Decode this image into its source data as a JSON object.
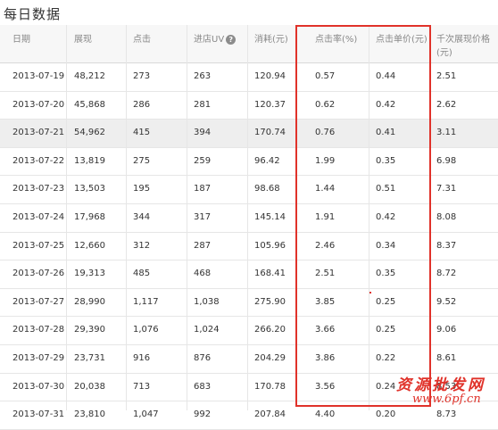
{
  "page": {
    "title": "每日数据"
  },
  "table": {
    "columns": [
      {
        "label": "日期"
      },
      {
        "label": "展现"
      },
      {
        "label": "点击"
      },
      {
        "label": "进店UV",
        "help_icon": "question-circle-icon"
      },
      {
        "label": "消耗(元)"
      },
      {
        "label": "点击率(%)"
      },
      {
        "label": "点击单价(元)"
      },
      {
        "label_line1": "千次展现价格",
        "label_line2": "(元)"
      }
    ],
    "rows": [
      [
        "2013-07-19",
        "48,212",
        "273",
        "263",
        "120.94",
        "0.57",
        "0.44",
        "2.51"
      ],
      [
        "2013-07-20",
        "45,868",
        "286",
        "281",
        "120.37",
        "0.62",
        "0.42",
        "2.62"
      ],
      [
        "2013-07-21",
        "54,962",
        "415",
        "394",
        "170.74",
        "0.76",
        "0.41",
        "3.11"
      ],
      [
        "2013-07-22",
        "13,819",
        "275",
        "259",
        "96.42",
        "1.99",
        "0.35",
        "6.98"
      ],
      [
        "2013-07-23",
        "13,503",
        "195",
        "187",
        "98.68",
        "1.44",
        "0.51",
        "7.31"
      ],
      [
        "2013-07-24",
        "17,968",
        "344",
        "317",
        "145.14",
        "1.91",
        "0.42",
        "8.08"
      ],
      [
        "2013-07-25",
        "12,660",
        "312",
        "287",
        "105.96",
        "2.46",
        "0.34",
        "8.37"
      ],
      [
        "2013-07-26",
        "19,313",
        "485",
        "468",
        "168.41",
        "2.51",
        "0.35",
        "8.72"
      ],
      [
        "2013-07-27",
        "28,990",
        "1,117",
        "1,038",
        "275.90",
        "3.85",
        "0.25",
        "9.52"
      ],
      [
        "2013-07-28",
        "29,390",
        "1,076",
        "1,024",
        "266.20",
        "3.66",
        "0.25",
        "9.06"
      ],
      [
        "2013-07-29",
        "23,731",
        "916",
        "876",
        "204.29",
        "3.86",
        "0.22",
        "8.61"
      ],
      [
        "2013-07-30",
        "20,038",
        "713",
        "683",
        "170.78",
        "3.56",
        "0.24",
        "8.53"
      ],
      [
        "2013-07-31",
        "23,810",
        "1,047",
        "992",
        "207.84",
        "4.40",
        "0.20",
        "8.73"
      ]
    ],
    "highlighted_row": "2013-07-21"
  },
  "watermark": {
    "text": "资源批发网",
    "url": "www.6pf.cn"
  },
  "colors": {
    "highlight_box": "#e0322a",
    "highlighted_row_bg": "#eeeeee"
  }
}
